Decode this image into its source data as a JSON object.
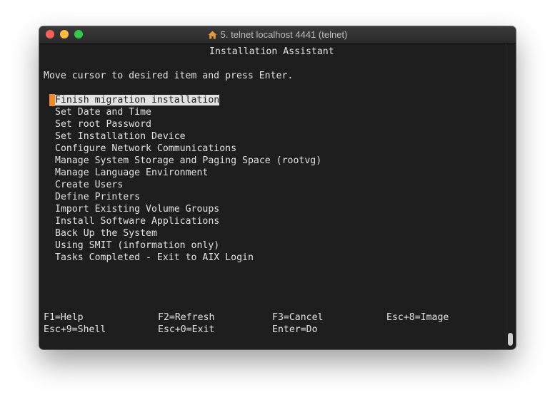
{
  "window": {
    "title": "5. telnet localhost 4441 (telnet)",
    "icon": "home-icon"
  },
  "terminal": {
    "heading": "Installation Assistant",
    "prompt": "Move cursor to desired item and press Enter.",
    "menu": [
      "Finish migration installation",
      "Set Date and Time",
      "Set root Password",
      "Set Installation Device",
      "Configure Network Communications",
      "Manage System Storage and Paging Space (rootvg)",
      "Manage Language Environment",
      "Create Users",
      "Define Printers",
      "Import Existing Volume Groups",
      "Install Software Applications",
      "Back Up the System",
      "Using SMIT (information only)",
      "Tasks Completed - Exit to AIX Login"
    ],
    "selected_index": 0,
    "function_keys": {
      "row1": [
        "F1=Help",
        "F2=Refresh",
        "F3=Cancel",
        "Esc+8=Image"
      ],
      "row2": [
        "Esc+9=Shell",
        "Esc+0=Exit",
        "Enter=Do"
      ]
    }
  },
  "colors": {
    "terminal_bg": "#1e1e1e",
    "terminal_fg": "#e2e2e2",
    "cursor": "#f08a24"
  }
}
